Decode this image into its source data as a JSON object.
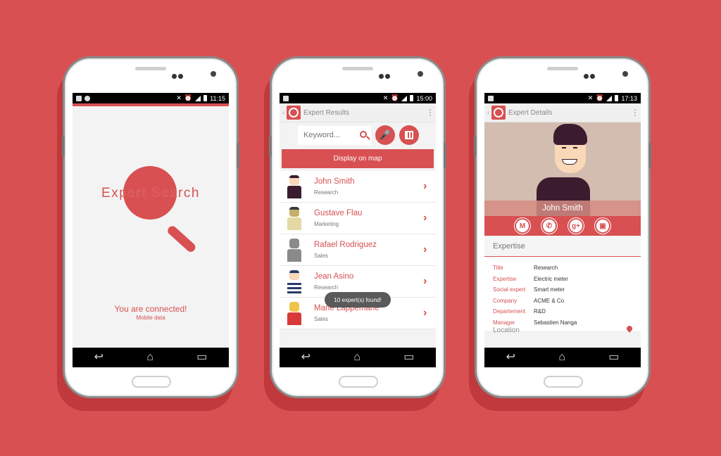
{
  "colors": {
    "background": "#d85052",
    "accent": "#d85052",
    "status_bar": "#000000"
  },
  "phone1": {
    "status_time": "11:15",
    "app_title": "Expert Search",
    "connection_status": "You are connected!",
    "connection_type": "Mobile data"
  },
  "phone2": {
    "status_time": "15:00",
    "screen_title": "Expert Results",
    "search_placeholder": "Keyword...",
    "map_button_label": "Display on map",
    "experts": [
      {
        "name": "John Smith",
        "department": "Research",
        "icon": "john-avatar"
      },
      {
        "name": "Gustave Flau",
        "department": "Marketing",
        "icon": "android-avatar"
      },
      {
        "name": "Rafael Rodriguez",
        "department": "Sales",
        "icon": "android-avatar"
      },
      {
        "name": "Jean Asino",
        "department": "Research",
        "icon": "android-avatar"
      },
      {
        "name": "Marie Lappemane",
        "department": "Sales",
        "icon": "android-avatar"
      }
    ],
    "toast": "10 expert(s) found!"
  },
  "phone3": {
    "status_time": "17:13",
    "screen_title": "Expert Details",
    "expert_name": "John Smith",
    "section_title": "Expertise",
    "details": [
      {
        "key": "Title",
        "value": "Research"
      },
      {
        "key": "Expertise",
        "value": "Electric meter"
      },
      {
        "key": "Social expert",
        "value": "Smart meter"
      },
      {
        "key": "Company",
        "value": "ACME & Co"
      },
      {
        "key": "Departement",
        "value": "R&D"
      },
      {
        "key": "Manager",
        "value": "Sebastien Nanga"
      }
    ],
    "location_label": "Location"
  }
}
